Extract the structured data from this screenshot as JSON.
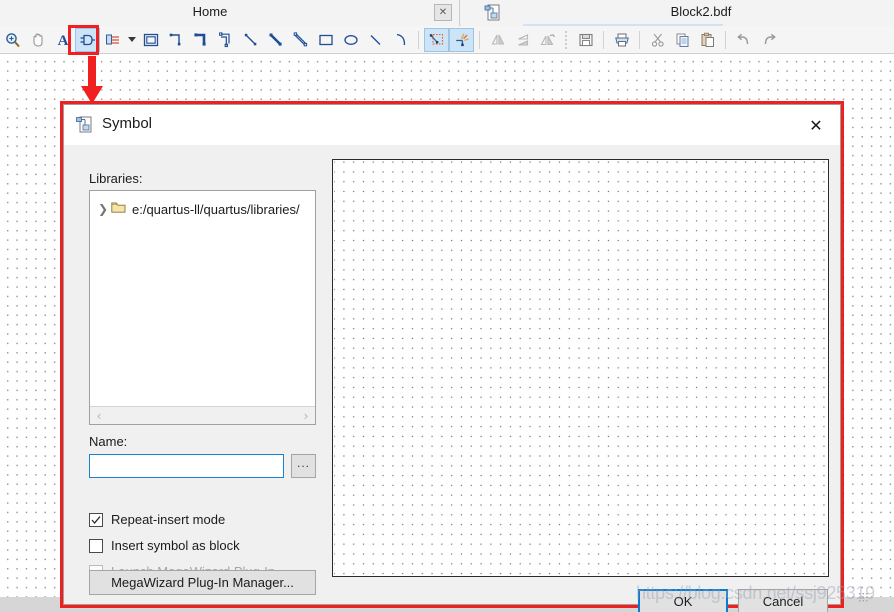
{
  "titlebar": {
    "home_tab_label": "Home",
    "home_close_glyph": "✕",
    "doc_icon_name": "block-diagram-file-icon",
    "doc_title": "Block2.bdf"
  },
  "toolbar": {
    "tools": [
      {
        "name": "zoom-tool",
        "title": "Zoom Tool",
        "active": false
      },
      {
        "name": "pan-tool",
        "title": "Hand / Pan Tool",
        "active": false
      },
      {
        "name": "text-tool",
        "title": "Text Tool",
        "active": false
      },
      {
        "name": "symbol-tool",
        "title": "Symbol Tool",
        "active": true
      },
      {
        "name": "pin-tool",
        "title": "Pin Tool",
        "active": false
      }
    ],
    "shape_tools": [
      {
        "name": "block-tool",
        "title": "Block Tool"
      },
      {
        "name": "orthogonal-node-line-tool",
        "title": "Orthogonal Node Line Tool"
      },
      {
        "name": "orthogonal-bus-line-tool",
        "title": "Orthogonal Bus Line Tool"
      },
      {
        "name": "orthogonal-conduit-line-tool",
        "title": "Orthogonal Conduit Line Tool"
      },
      {
        "name": "diagonal-node-line-tool",
        "title": "Diagonal Node Line Tool"
      },
      {
        "name": "diagonal-bus-line-tool",
        "title": "Diagonal Bus Line Tool"
      },
      {
        "name": "diagonal-conduit-line-tool",
        "title": "Diagonal Conduit Line Tool"
      },
      {
        "name": "rectangle-tool",
        "title": "Rectangle Tool"
      },
      {
        "name": "oval-tool",
        "title": "Oval Tool"
      },
      {
        "name": "line-tool",
        "title": "Line Tool"
      },
      {
        "name": "arc-tool",
        "title": "Arc Tool"
      }
    ],
    "selection_tools": [
      {
        "name": "rubberband-selection-tool",
        "title": "Rubberband Selection",
        "active": true
      },
      {
        "name": "partial-line-selection-tool",
        "title": "Partial Line Selection",
        "active": true
      }
    ],
    "flip_tools": [
      {
        "name": "flip-horizontal-icon",
        "title": "Flip Horizontal"
      },
      {
        "name": "flip-vertical-icon",
        "title": "Flip Vertical"
      },
      {
        "name": "rotate-left-icon",
        "title": "Rotate Left 90"
      }
    ],
    "file_tools": [
      {
        "name": "save-icon",
        "title": "Save"
      },
      {
        "name": "print-icon",
        "title": "Print"
      }
    ],
    "clipboard_tools": [
      {
        "name": "cut-icon",
        "title": "Cut"
      },
      {
        "name": "copy-icon",
        "title": "Copy"
      },
      {
        "name": "paste-icon",
        "title": "Paste"
      }
    ],
    "history_tools": [
      {
        "name": "undo-icon",
        "title": "Undo"
      },
      {
        "name": "redo-icon",
        "title": "Redo"
      }
    ]
  },
  "dialog": {
    "title": "Symbol",
    "icon_name": "symbol-dialog-icon",
    "close_glyph": "✕",
    "libraries_label": "Libraries:",
    "library_items": [
      {
        "label": "e:/quartus-ll/quartus/libraries/",
        "expanded": false
      }
    ],
    "scroll_left_glyph": "‹",
    "scroll_right_glyph": "›",
    "name_label": "Name:",
    "name_value": "",
    "name_placeholder": "",
    "browse_label": "...",
    "checkboxes": [
      {
        "label": "Repeat-insert mode",
        "checked": true,
        "disabled": false
      },
      {
        "label": "Insert symbol as block",
        "checked": false,
        "disabled": false
      },
      {
        "label": "Launch MegaWizard Plug-In",
        "checked": false,
        "disabled": true
      }
    ],
    "megawizard_button": "MegaWizard Plug-In Manager...",
    "ok_label": "OK",
    "cancel_label": "Cancel"
  },
  "annotation": {
    "highlight_color": "#f02020",
    "arrow_color": "#f02020"
  },
  "watermark": {
    "text": "https://blog.csdn.net/ssj925319"
  }
}
